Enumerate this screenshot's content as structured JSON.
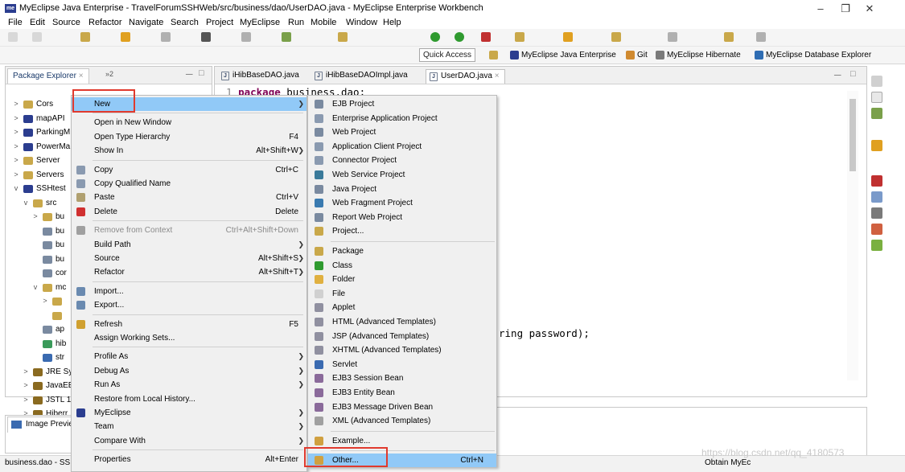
{
  "title_bar": {
    "logo": "me",
    "title": "MyEclipse Java Enterprise - TravelForumSSHWeb/src/business/dao/UserDAO.java - MyEclipse Enterprise Workbench"
  },
  "menu": [
    "File",
    "Edit",
    "Source",
    "Refactor",
    "Navigate",
    "Search",
    "Project",
    "MyEclipse",
    "Run",
    "Mobile",
    "Window",
    "Help"
  ],
  "perspective_bar": {
    "quick_access": "Quick Access",
    "perspectives": [
      "MyEclipse Java Enterprise",
      "Git",
      "MyEclipse Hibernate",
      "MyEclipse Database Explorer"
    ]
  },
  "package_explorer": {
    "tab": "Package Explorer",
    "tab_extra": "»2",
    "tree": [
      "Cors",
      "mapAPI",
      "ParkingM",
      "PowerMa",
      "Server",
      "Servers",
      "SSHtest",
      "src",
      "bu",
      "bu",
      "bu",
      "bu",
      "cor",
      "mc",
      "",
      "",
      "ap",
      "hib",
      "str",
      "JRE Sy",
      "JavaEE",
      "JSTL 1",
      "Hiberr"
    ]
  },
  "editor": {
    "tabs": [
      "iHibBaseDAO.java",
      "iHibBaseDAOImpl.java",
      "UserDAO.java"
    ],
    "active_tab": "UserDAO.java",
    "line_number": "1",
    "code_line_keyword": "package",
    "code_line_rest": " business.dao;",
    "code_fragment": "ring password);"
  },
  "image_preview": {
    "tab": "Image Previe"
  },
  "status_bar": {
    "left": "business.dao - SS",
    "right": "Obtain MyEc"
  },
  "context_menu": [
    {
      "label": "New",
      "shortcut": "",
      "arrow": true,
      "highlighted": true
    },
    {
      "sep": true
    },
    {
      "label": "Open in New Window",
      "shortcut": ""
    },
    {
      "label": "Open Type Hierarchy",
      "shortcut": "F4"
    },
    {
      "label": "Show In",
      "shortcut": "Alt+Shift+W",
      "arrow": true
    },
    {
      "sep": true
    },
    {
      "label": "Copy",
      "shortcut": "Ctrl+C",
      "icon": "copy-icon"
    },
    {
      "label": "Copy Qualified Name",
      "shortcut": "",
      "icon": "copy-icon"
    },
    {
      "label": "Paste",
      "shortcut": "Ctrl+V",
      "icon": "paste-icon"
    },
    {
      "label": "Delete",
      "shortcut": "Delete",
      "icon": "delete-icon"
    },
    {
      "sep": true
    },
    {
      "label": "Remove from Context",
      "shortcut": "Ctrl+Alt+Shift+Down",
      "disabled": true,
      "icon": "remove-icon"
    },
    {
      "label": "Build Path",
      "shortcut": "",
      "arrow": true
    },
    {
      "label": "Source",
      "shortcut": "Alt+Shift+S",
      "arrow": true
    },
    {
      "label": "Refactor",
      "shortcut": "Alt+Shift+T",
      "arrow": true
    },
    {
      "sep": true
    },
    {
      "label": "Import...",
      "shortcut": "",
      "icon": "import-icon"
    },
    {
      "label": "Export...",
      "shortcut": "",
      "icon": "export-icon"
    },
    {
      "sep": true
    },
    {
      "label": "Refresh",
      "shortcut": "F5",
      "icon": "refresh-icon"
    },
    {
      "label": "Assign Working Sets...",
      "shortcut": ""
    },
    {
      "sep": true
    },
    {
      "label": "Profile As",
      "shortcut": "",
      "arrow": true
    },
    {
      "label": "Debug As",
      "shortcut": "",
      "arrow": true
    },
    {
      "label": "Run As",
      "shortcut": "",
      "arrow": true
    },
    {
      "label": "Restore from Local History...",
      "shortcut": ""
    },
    {
      "label": "MyEclipse",
      "shortcut": "",
      "arrow": true,
      "icon": "myeclipse-icon"
    },
    {
      "label": "Team",
      "shortcut": "",
      "arrow": true
    },
    {
      "label": "Compare With",
      "shortcut": "",
      "arrow": true
    },
    {
      "sep": true
    },
    {
      "label": "Properties",
      "shortcut": "Alt+Enter"
    }
  ],
  "submenu": [
    {
      "label": "EJB Project",
      "shortcut": ""
    },
    {
      "label": "Enterprise Application Project",
      "shortcut": ""
    },
    {
      "label": "Web Project",
      "shortcut": ""
    },
    {
      "label": "Application Client Project",
      "shortcut": ""
    },
    {
      "label": "Connector Project",
      "shortcut": ""
    },
    {
      "label": "Web Service Project",
      "shortcut": ""
    },
    {
      "label": "Java Project",
      "shortcut": ""
    },
    {
      "label": "Web Fragment Project",
      "shortcut": ""
    },
    {
      "label": "Report Web Project",
      "shortcut": ""
    },
    {
      "label": "Project...",
      "shortcut": ""
    },
    {
      "sep": true
    },
    {
      "label": "Package",
      "shortcut": ""
    },
    {
      "label": "Class",
      "shortcut": ""
    },
    {
      "label": "Folder",
      "shortcut": ""
    },
    {
      "label": "File",
      "shortcut": ""
    },
    {
      "label": "Applet",
      "shortcut": ""
    },
    {
      "label": "HTML (Advanced Templates)",
      "shortcut": ""
    },
    {
      "label": "JSP (Advanced Templates)",
      "shortcut": ""
    },
    {
      "label": "XHTML (Advanced Templates)",
      "shortcut": ""
    },
    {
      "label": "Servlet",
      "shortcut": ""
    },
    {
      "label": "EJB3 Session Bean",
      "shortcut": ""
    },
    {
      "label": "EJB3 Entity Bean",
      "shortcut": ""
    },
    {
      "label": "EJB3 Message Driven Bean",
      "shortcut": ""
    },
    {
      "label": "XML (Advanced Templates)",
      "shortcut": ""
    },
    {
      "sep": true
    },
    {
      "label": "Example...",
      "shortcut": ""
    },
    {
      "sep": true
    },
    {
      "label": "Other...",
      "shortcut": "Ctrl+N",
      "highlighted": true
    }
  ],
  "watermark": "https://blog.csdn.net/qq_4180573"
}
